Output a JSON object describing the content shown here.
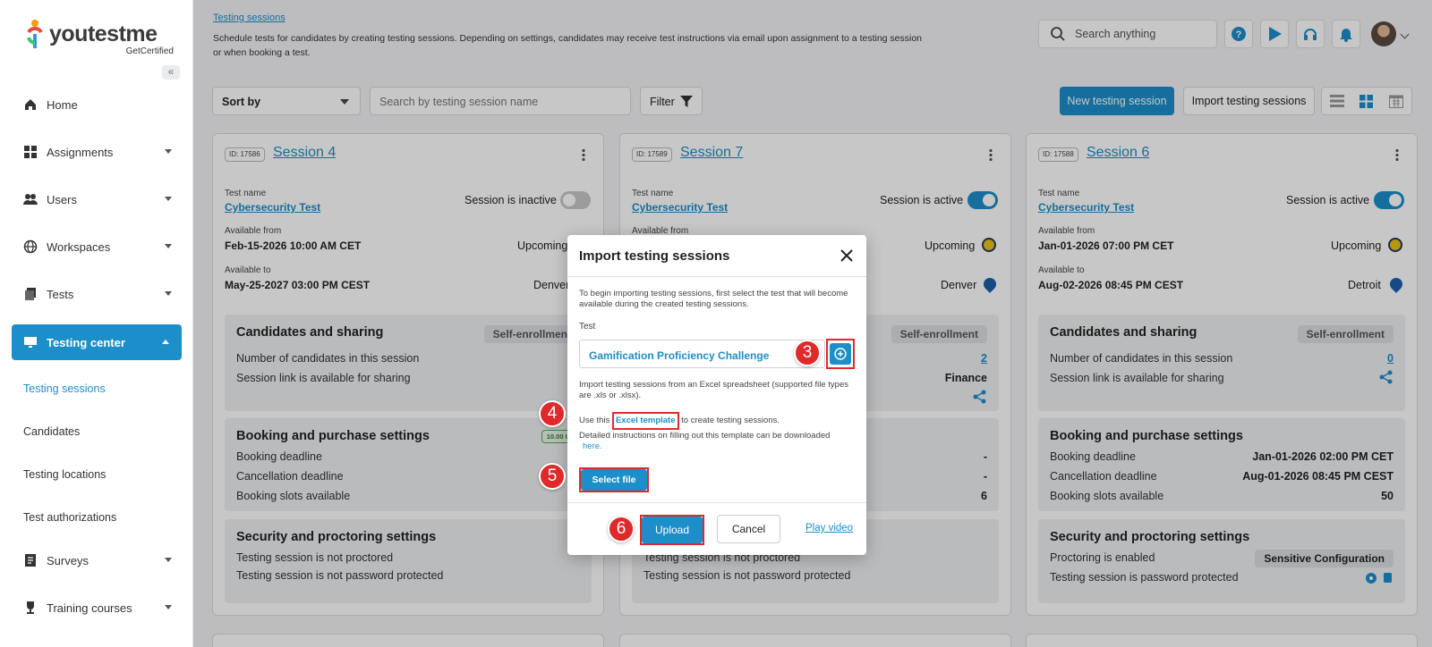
{
  "brand": {
    "name": "youtestme",
    "sub": "GetCertified",
    "colors": {
      "primary": "#1c8ec9",
      "highlight": "#e0292b"
    }
  },
  "sidebar": {
    "collapse_icon": "double-chevron-left-icon",
    "items": [
      {
        "label": "Home",
        "icon": "home-icon"
      },
      {
        "label": "Assignments",
        "icon": "assignments-icon"
      },
      {
        "label": "Users",
        "icon": "users-icon"
      },
      {
        "label": "Workspaces",
        "icon": "globe-icon"
      },
      {
        "label": "Tests",
        "icon": "tests-icon"
      },
      {
        "label": "Testing center",
        "icon": "monitor-icon"
      },
      {
        "label": "Surveys",
        "icon": "survey-icon"
      },
      {
        "label": "Training courses",
        "icon": "trophy-icon"
      }
    ],
    "subitems": [
      "Testing sessions",
      "Candidates",
      "Testing locations",
      "Test authorizations"
    ]
  },
  "header": {
    "breadcrumb": "Testing sessions",
    "description": "Schedule tests for candidates by creating testing sessions. Depending on settings, candidates may receive test instructions via email upon assignment to a testing session or when booking a test.",
    "search_placeholder": "Search anything"
  },
  "toolbar": {
    "sort_label": "Sort by",
    "search_placeholder": "Search by testing session name",
    "filter_label": "Filter",
    "new_label": "New testing session",
    "import_label": "Import testing sessions"
  },
  "cards": [
    {
      "id": "ID: 17586",
      "title": "Session 4",
      "test_label": "Test name",
      "test_name": "Cybersecurity Test",
      "status_text": "Session is inactive",
      "from_label": "Available from",
      "from_value": "Feb-15-2026 10:00 AM CET",
      "timing": "Upcoming",
      "to_label": "Available to",
      "to_value": "May-25-2027 03:00 PM CEST",
      "location": "Denver",
      "cand_title": "Candidates and sharing",
      "cand_badge": "Self-enrollment",
      "cand_rows": [
        "Number of candidates in this session",
        "Session link is available for sharing"
      ],
      "booking_title": "Booking and purchase settings",
      "booking_badge": "10.00 US",
      "booking_rows": [
        "Booking deadline",
        "Cancellation deadline",
        "Booking slots available"
      ],
      "sec_title": "Security and proctoring settings",
      "sec_rows": [
        "Testing session is not proctored",
        "Testing session is not password protected"
      ]
    },
    {
      "id": "ID: 17589",
      "title": "Session 7",
      "test_label": "Test name",
      "test_name": "Cybersecurity Test",
      "status_text": "Session is active",
      "from_label": "Available from",
      "timing": "Upcoming",
      "location": "Denver",
      "cand_badge": "Self-enrollment",
      "cand_count": "2",
      "cand_group": "Finance",
      "booking_vals": [
        "-",
        "-",
        "6"
      ],
      "sec_rows": [
        "Testing session is not proctored",
        "Testing session is not password protected"
      ]
    },
    {
      "id": "ID: 17588",
      "title": "Session 6",
      "test_label": "Test name",
      "test_name": "Cybersecurity Test",
      "status_text": "Session is active",
      "from_label": "Available from",
      "from_value": "Jan-01-2026 07:00 PM CET",
      "timing": "Upcoming",
      "to_label": "Available to",
      "to_value": "Aug-02-2026 08:45 PM CEST",
      "location": "Detroit",
      "cand_title": "Candidates and sharing",
      "cand_badge": "Self-enrollment",
      "cand_count": "0",
      "cand_rows": [
        "Number of candidates in this session",
        "Session link is available for sharing"
      ],
      "booking_title": "Booking and purchase settings",
      "booking_rows": [
        "Booking deadline",
        "Cancellation deadline",
        "Booking slots available"
      ],
      "booking_vals": [
        "Jan-01-2026 02:00 PM CET",
        "Aug-01-2026 08:45 PM CEST",
        "50"
      ],
      "sec_title": "Security and proctoring settings",
      "sec_badge": "Sensitive Configuration",
      "sec_rows": [
        "Proctoring is enabled",
        "Testing session is password protected"
      ]
    }
  ],
  "modal": {
    "title": "Import testing sessions",
    "intro": "To begin importing testing sessions, first select the test that will become available during the created testing sessions.",
    "test_label": "Test",
    "test_value": "Gamification Proficiency Challenge",
    "import_text": "Import testing sessions from an Excel spreadsheet (supported file types are .xls or .xlsx).",
    "use_prefix": "Use this",
    "template_link": "Excel template",
    "use_suffix": "to create testing sessions.",
    "detail_text": "Detailed instructions on filling out this template can be downloaded",
    "here_link": "here.",
    "select_file": "Select file",
    "upload": "Upload",
    "cancel": "Cancel",
    "play_video": "Play video"
  },
  "steps": [
    "3",
    "4",
    "5",
    "6"
  ]
}
